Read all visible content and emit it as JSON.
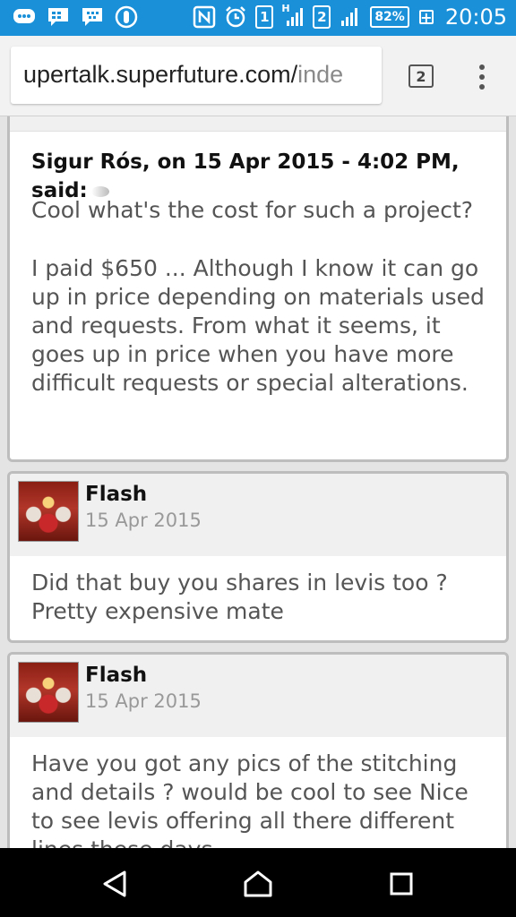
{
  "status_bar": {
    "left_icons": [
      "more-icon",
      "message-icon",
      "bbm-icon",
      "sync-icon"
    ],
    "right_icons": [
      "nfc-icon",
      "alarm-icon"
    ],
    "sim1": "1",
    "sim1_network": "H",
    "sim2": "2",
    "battery": "82%",
    "time": "20:05",
    "accent": "#1a90d9"
  },
  "browser": {
    "url_visible": "upertalk.superfuture.com/",
    "url_dim": "inde",
    "tab_count": "2"
  },
  "posts": [
    {
      "quote_head": "Sigur Rós, on 15 Apr 2015 - 4:02 PM, said:",
      "quote_text": "Cool what's the cost for such a project?",
      "body": "I paid $650 ... Although I know it can go up in price depending on materials used and requests. From what it seems, it goes up in price when you have more difficult requests or special alterations."
    },
    {
      "author": "Flash",
      "date": "15 Apr 2015",
      "body": "Did that buy you shares in levis too ? Pretty expensive mate"
    },
    {
      "author": "Flash",
      "date": "15 Apr 2015",
      "body": "Have you got any pics of the stitching and details ? would be cool to see Nice to see levis offering all there different lines these days"
    }
  ]
}
